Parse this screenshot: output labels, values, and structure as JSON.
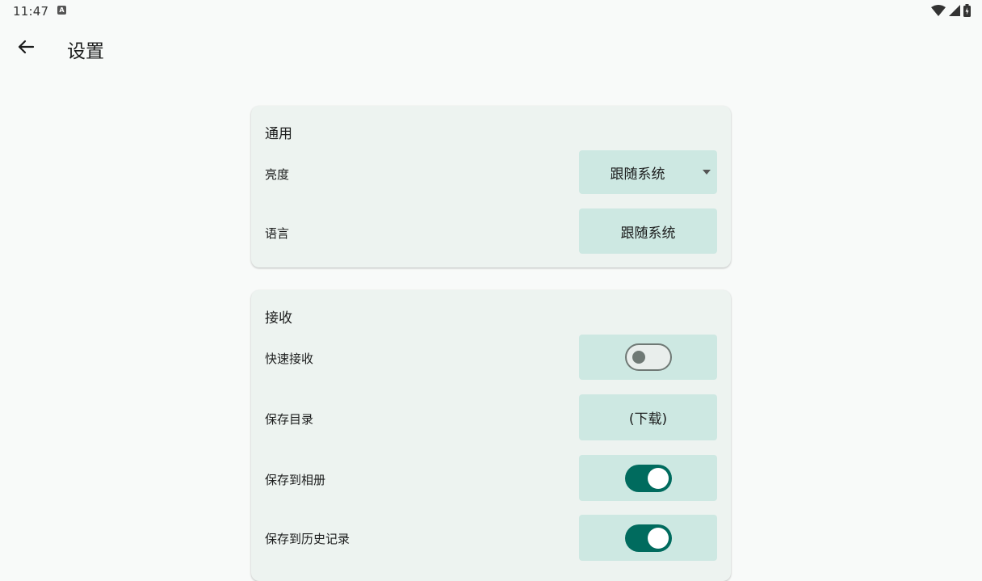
{
  "status_bar": {
    "time": "11:47",
    "notification_icon": "A"
  },
  "app_bar": {
    "title": "设置"
  },
  "general": {
    "title": "通用",
    "brightness_label": "亮度",
    "brightness_value": "跟随系统",
    "language_label": "语言",
    "language_value": "跟随系统"
  },
  "receive": {
    "title": "接收",
    "quick_receive_label": "快速接收",
    "quick_receive_on": false,
    "save_dir_label": "保存目录",
    "save_dir_value": "(下载)",
    "save_to_album_label": "保存到相册",
    "save_to_album_on": true,
    "save_to_history_label": "保存到历史记录",
    "save_to_history_on": true
  },
  "colors": {
    "background": "#f8faf9",
    "card": "#edf3f0",
    "control": "#cde8e2",
    "accent": "#006b5e"
  }
}
